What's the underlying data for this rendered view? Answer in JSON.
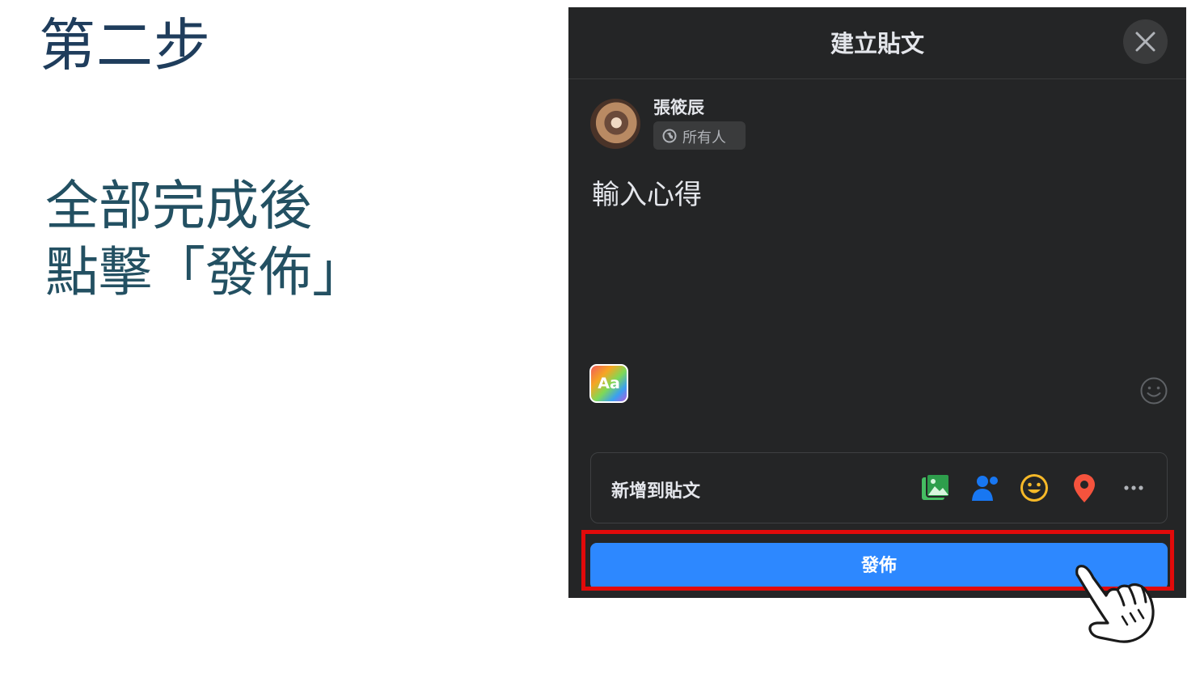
{
  "slide": {
    "title": "第二步",
    "instruction_line1": "全部完成後",
    "instruction_line2": "點擊「發佈」"
  },
  "dialog": {
    "title": "建立貼文",
    "close_icon": "close-icon",
    "user": {
      "name": "張筱辰",
      "audience": "所有人",
      "audience_icon": "globe-icon"
    },
    "post_text": "輸入心得",
    "text_style_button": "Aa",
    "emoji_icon": "emoji-smile-icon",
    "add_to_post": {
      "label": "新增到貼文",
      "icons": [
        "photo-video-icon",
        "tag-people-icon",
        "feeling-icon",
        "check-in-icon",
        "more-icon"
      ]
    },
    "publish_button": "發佈"
  },
  "colors": {
    "title_text": "#1f3d5c",
    "instruction_text": "#235062",
    "dialog_bg": "#242526",
    "publish_blue": "#2d88ff",
    "highlight_red": "#e20a0a"
  }
}
